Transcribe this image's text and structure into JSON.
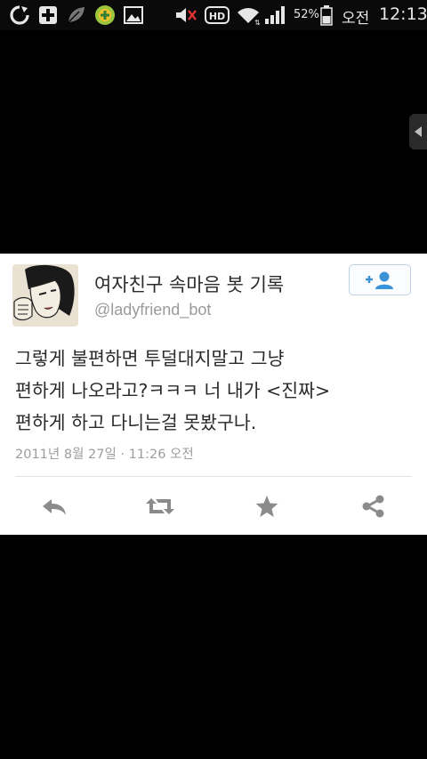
{
  "status_bar": {
    "battery_percent": "52%",
    "ampm": "오전",
    "time": "12:13",
    "icons": [
      "sync-icon",
      "medical-plus-icon",
      "leaf-icon",
      "app-badge-icon",
      "image-icon",
      "mute-icon",
      "hd-icon",
      "wifi-icon",
      "signal-icon",
      "battery-icon"
    ]
  },
  "tweet": {
    "display_name": "여자친구 속마음 봇 기록",
    "handle": "@ladyfriend_bot",
    "follow_icon": "follow-user-icon",
    "text_lines": [
      "그렇게 불편하면 투덜대지말고 그냥",
      "편하게 나오라고?ㅋㅋㅋ 너 내가 <진짜>",
      "편하게 하고 다니는걸 못봤구나."
    ],
    "timestamp": "2011년 8월 27일 · 11:26 오전",
    "actions": [
      "reply-icon",
      "retweet-icon",
      "favorite-icon",
      "share-icon"
    ]
  },
  "colors": {
    "background": "#000000",
    "card": "#ffffff",
    "text": "#2a2a2a",
    "muted": "#9a9a9a",
    "icon": "#8b8b8b",
    "follow_accent": "#3a93d6"
  }
}
